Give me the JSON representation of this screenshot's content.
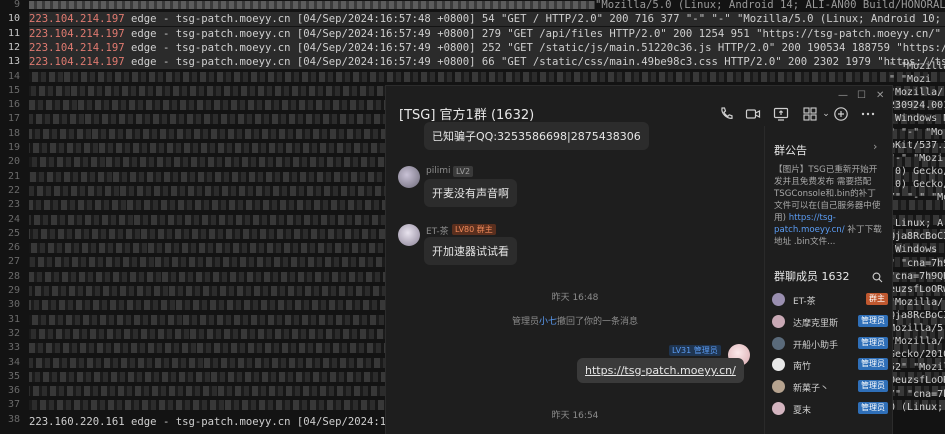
{
  "editor": {
    "line_numbers": [
      "9",
      "10",
      "11",
      "12",
      "13",
      "14",
      "15",
      "16",
      "17",
      "18",
      "19",
      "20",
      "21",
      "22",
      "23",
      "24",
      "25",
      "26",
      "27",
      "28",
      "29",
      "30",
      "31",
      "32",
      "33",
      "34",
      "35",
      "36",
      "37",
      "38"
    ],
    "top_lines": [
      {
        "ip": "223.104.214.197",
        "rest": " edge - tsg-patch.moeyy.cn [04/Sep/2024:16:57:48 +0800] 54 \"GET / HTTP/2.0\" 200 716 377 \"-\" \"-\" \"Mozilla/5.0 (Linux; Android 10; SPN-AL00 Build/HUAWEISPN-"
      },
      {
        "ip": "223.104.214.197",
        "rest": " edge - tsg-patch.moeyy.cn [04/Sep/2024:16:57:49 +0800] 279 \"GET /api/files HTTP/2.0\" 200 1254 951 \"https://tsg-patch.moeyy.cn/\" \"-\" \"Mozilla/5.0 (Linux;"
      },
      {
        "ip": "223.104.214.197",
        "rest": " edge - tsg-patch.moeyy.cn [04/Sep/2024:16:57:49 +0800] 252 \"GET /static/js/main.51220c36.js HTTP/2.0\" 200 190534 188759 \"https://tsg-patch.moeyy.cn/\" \"-\" \""
      },
      {
        "ip": "223.104.214.197",
        "rest": " edge - tsg-patch.moeyy.cn [04/Sep/2024:16:57:49 +0800] 66 \"GET /static/css/main.49be98c3.css HTTP/2.0\" 200 2302 1979 \"https://tsg-patch.moeyy.cn/\" \"-\" \"Mozi"
      }
    ],
    "top_line_partial": "\"Mozilla/5.0 (Linux; Android 14; ALI-AN00 Build/HONORALI-AN00)",
    "bottom_line": {
      "ip": "223.160.220.161",
      "rest": " edge - tsg-patch.moeyy.cn [04/Sep/2024:16:07:58 +0"
    },
    "right_fragments": [
      "\" \"Mozilla/",
      "\" \"Mozi",
      "\"Mozilla/",
      "230924.001",
      "(Windows N",
      "\" \"-\" \"Mo",
      "bKit/537.3",
      "\"-\" \"Mozi",
      ".0) Gecko/",
      ".0) Gecko/",
      "/\" \"-\" \"Mo",
      "",
      "(Linux; A",
      "Qja8RcBoCI",
      "(Windows",
      "\" \"cna=7h9",
      "\"cna=7h9QH",
      "euzsfLoORw",
      "\"Mozilla/",
      "Qja8RcBoCI",
      "Mozilla/5.",
      "\"Mozilla/",
      "Gecko/2010",
      "52\" \"Mozil",
      "OeuzsfLoOR",
      "/\" \"cna=7h",
      "0 (Linux;"
    ]
  },
  "chat": {
    "window_controls": {
      "minimize": "—",
      "restore": "☐",
      "close": "✕"
    },
    "title_tag": "[TSG]",
    "title": " 官方1群 (1632)",
    "toolbar_icons": [
      "phone-icon",
      "video-icon",
      "screen-share-icon",
      "apps-icon",
      "add-icon",
      "more-icon"
    ],
    "messages": {
      "m1_text": "已知骗子QQ:3253586698|2875438306",
      "m2_user": "pilimi",
      "m2_level": "LV2",
      "m2_text": "开麦没有声音啊",
      "m3_user": "ET-茶",
      "m3_level": "LV80 群主",
      "m3_text": "开加速器试试看",
      "time1": "昨天 16:48",
      "sys_prefix": "管理员",
      "sys_name": "小七",
      "sys_suffix": "撤回了你的一条消息",
      "me_level": "LV31 管理员",
      "me_link": "https://tsg-patch.moeyy.cn/",
      "time2": "昨天 16:54"
    },
    "side": {
      "notice_title": "群公告",
      "notice_text_1": "【图片】TSG已重新开始开发并且免费发布 需要搭配TSGConsole和.bin的补丁文件可以在(自己服务器中使用)",
      "notice_link": "https://tsg-patch.moeyy.cn/",
      "notice_text_2": " 补丁下载地址 .bin文件...",
      "members_title": "群聊成员 1632",
      "members": [
        {
          "name": "ET-茶",
          "tag": "群主",
          "tag_color": "#c0582f"
        },
        {
          "name": "达摩克里斯",
          "tag": "管理员",
          "tag_color": "#2f6fb8"
        },
        {
          "name": "开船小助手",
          "tag": "管理员",
          "tag_color": "#2f6fb8"
        },
        {
          "name": "南竹",
          "tag": "管理员",
          "tag_color": "#2f6fb8"
        },
        {
          "name": "新菓子丶",
          "tag": "管理员",
          "tag_color": "#2f6fb8"
        },
        {
          "name": "夏末",
          "tag": "管理员",
          "tag_color": "#2f6fb8"
        }
      ]
    }
  }
}
